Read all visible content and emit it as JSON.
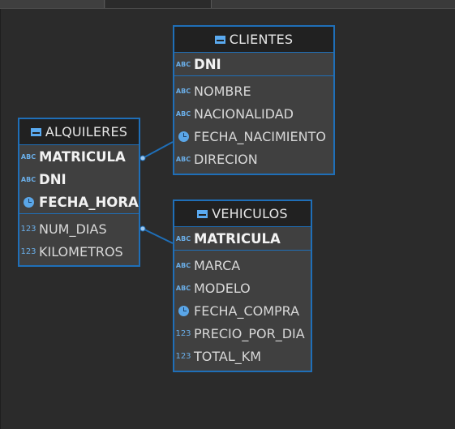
{
  "diagram": {
    "entities": [
      {
        "id": "clientes",
        "name": "CLIENTES",
        "key_attributes": [
          {
            "name": "DNI",
            "type": "abc"
          }
        ],
        "attributes": [
          {
            "name": "NOMBRE",
            "type": "abc"
          },
          {
            "name": "NACIONALIDAD",
            "type": "abc"
          },
          {
            "name": "FECHA_NACIMIENTO",
            "type": "date"
          },
          {
            "name": "DIRECION",
            "type": "abc"
          }
        ]
      },
      {
        "id": "alquileres",
        "name": "ALQUILERES",
        "key_attributes": [
          {
            "name": "MATRICULA",
            "type": "abc"
          },
          {
            "name": "DNI",
            "type": "abc"
          },
          {
            "name": "FECHA_HORA",
            "type": "date"
          }
        ],
        "attributes": [
          {
            "name": "NUM_DIAS",
            "type": "num"
          },
          {
            "name": "KILOMETROS",
            "type": "num"
          }
        ]
      },
      {
        "id": "vehiculos",
        "name": "VEHICULOS",
        "key_attributes": [
          {
            "name": "MATRICULA",
            "type": "abc"
          }
        ],
        "attributes": [
          {
            "name": "MARCA",
            "type": "abc"
          },
          {
            "name": "MODELO",
            "type": "abc"
          },
          {
            "name": "FECHA_COMPRA",
            "type": "date"
          },
          {
            "name": "PRECIO_POR_DIA",
            "type": "num"
          },
          {
            "name": "TOTAL_KM",
            "type": "num"
          }
        ]
      }
    ],
    "relationships": [
      {
        "from": "alquileres",
        "to": "clientes"
      },
      {
        "from": "alquileres",
        "to": "vehiculos"
      }
    ],
    "type_icons": {
      "abc": "ABC",
      "num": "123",
      "date": "clock-icon"
    },
    "colors": {
      "border": "#1f6fb8",
      "header": "#212121",
      "body": "#404040",
      "icon": "#5aa6e8"
    }
  }
}
